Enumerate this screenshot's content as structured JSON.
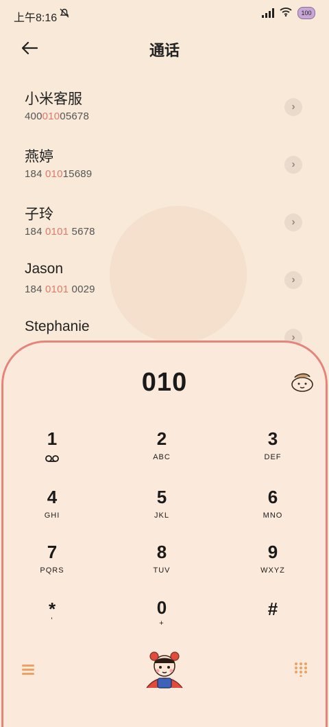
{
  "status_bar": {
    "time": "上午8:16",
    "battery": "100"
  },
  "header": {
    "title": "通话"
  },
  "contacts": [
    {
      "name": "小米客服",
      "number_pre": "400",
      "number_match": "010",
      "number_post": "05678"
    },
    {
      "name": "燕婷",
      "number_pre": "184 ",
      "number_match": "010",
      "number_post": "15689"
    },
    {
      "name": "子玲",
      "number_pre": "184 ",
      "number_match": "0101",
      "number_post": " 5678"
    },
    {
      "name": "Jason",
      "number_pre": "184 ",
      "number_match": "0101",
      "number_post": " 0029"
    },
    {
      "name": "Stephanie",
      "number_pre": "",
      "number_match": "",
      "number_post": ""
    }
  ],
  "dialer": {
    "display": "010",
    "keys": [
      {
        "digit": "1",
        "letters": ""
      },
      {
        "digit": "2",
        "letters": "ABC"
      },
      {
        "digit": "3",
        "letters": "DEF"
      },
      {
        "digit": "4",
        "letters": "GHI"
      },
      {
        "digit": "5",
        "letters": "JKL"
      },
      {
        "digit": "6",
        "letters": "MNO"
      },
      {
        "digit": "7",
        "letters": "PQRS"
      },
      {
        "digit": "8",
        "letters": "TUV"
      },
      {
        "digit": "9",
        "letters": "WXYZ"
      },
      {
        "digit": "*",
        "letters": "'"
      },
      {
        "digit": "0",
        "letters": "+"
      },
      {
        "digit": "#",
        "letters": ""
      }
    ]
  },
  "colors": {
    "background": "#f8e9d8",
    "accent": "#e5847a",
    "highlight": "#e07a6b",
    "icon_orange": "#f0a060"
  },
  "icons": {
    "back": "arrow-left-icon",
    "chevron": "chevron-right-icon",
    "voicemail": "voicemail-icon",
    "menu": "menu-icon",
    "keypad": "keypad-icon"
  }
}
